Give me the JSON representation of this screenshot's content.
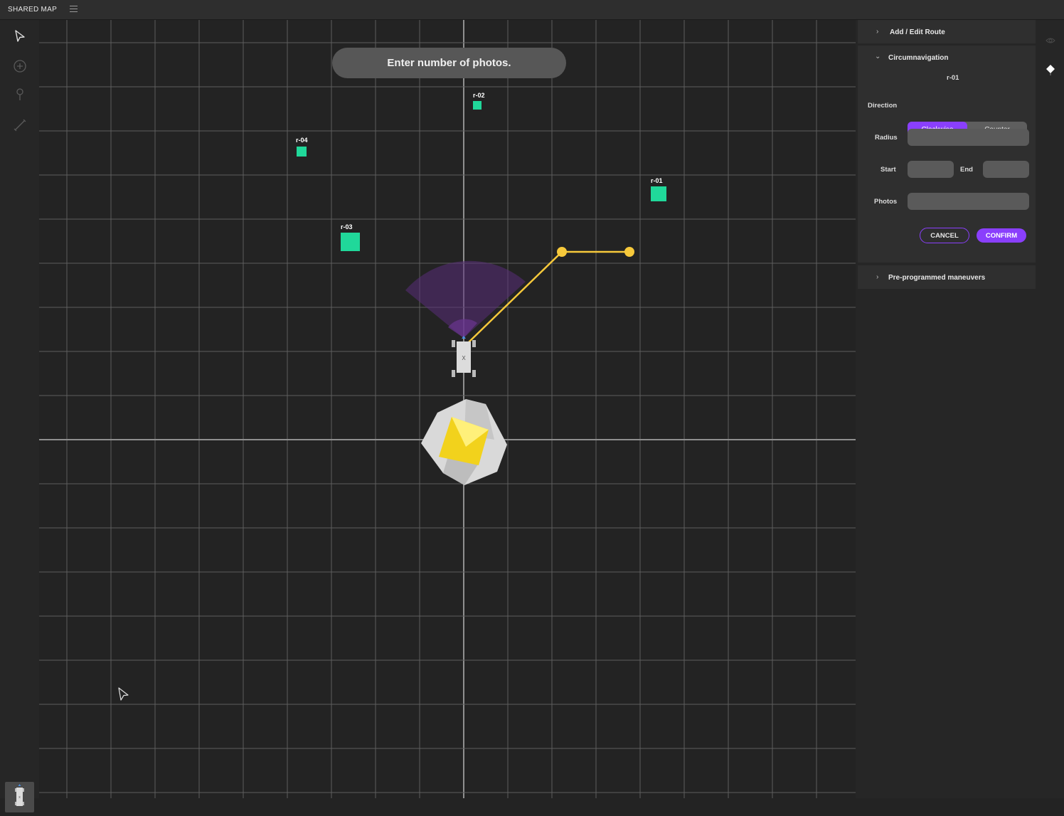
{
  "app": {
    "title": "SHARED MAP"
  },
  "toast": {
    "text": "Enter number of photos."
  },
  "map": {
    "targets": [
      {
        "id": "r-01"
      },
      {
        "id": "r-02"
      },
      {
        "id": "r-03"
      },
      {
        "id": "r-04"
      }
    ],
    "vehicle_label": "X",
    "route_color": "#f7c93b",
    "target_color": "#20d89a",
    "sensor_color": "#5a2e7a"
  },
  "panel": {
    "add_edit_route": "Add / Edit Route",
    "circumnavigation": {
      "title": "Circumnavigation",
      "target": "r-01",
      "direction_label": "Direction",
      "direction_options": [
        "Clockwise",
        "Counter"
      ],
      "direction_selected": "Clockwise",
      "radius_label": "Radius",
      "radius_value": "",
      "start_label": "Start",
      "start_value": "",
      "end_label": "End",
      "end_value": "",
      "photos_label": "Photos",
      "photos_value": "",
      "cancel_label": "CANCEL",
      "confirm_label": "CONFIRM"
    },
    "preprogrammed": "Pre-programmed maneuvers"
  },
  "colors": {
    "accent": "#8a3ffc",
    "background": "#232323",
    "panel": "#2f2f2f"
  },
  "icons": [
    "menu-icon",
    "pointer-icon",
    "add-circle-icon",
    "pin-icon",
    "line-icon",
    "eye-icon",
    "diamond-icon",
    "vehicle-icon"
  ]
}
